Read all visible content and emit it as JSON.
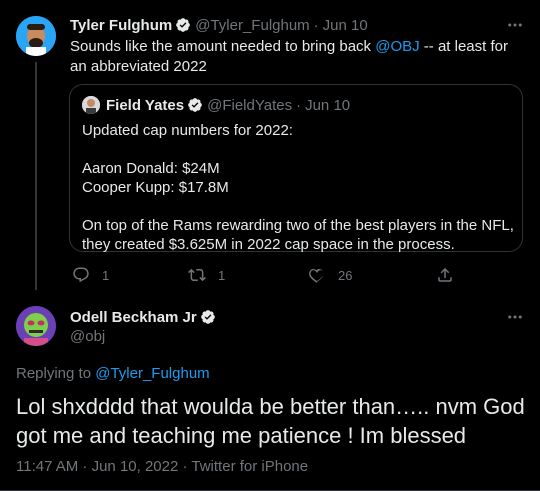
{
  "tweet": {
    "author_name": "Tyler Fulghum",
    "author_handle": "@Tyler_Fulghum",
    "separator": "·",
    "date": "Jun 10",
    "text_before_mention": "Sounds like the amount needed to bring back ",
    "mention": "@OBJ",
    "text_after_mention": " -- at least for an abbreviated 2022",
    "quoted": {
      "author_name": "Field Yates",
      "author_handle": "@FieldYates",
      "separator": "·",
      "date": "Jun 10",
      "lines": [
        "Updated cap numbers for 2022:",
        "",
        "Aaron Donald: $24M",
        "Cooper Kupp: $17.8M",
        "",
        "On top of the Rams rewarding two of the best players in the NFL, they created $3.625M in 2022 cap space in the process."
      ]
    },
    "actions": {
      "reply_count": "1",
      "retweet_count": "1",
      "like_count": "26",
      "reply_icon": "reply-icon",
      "retweet_icon": "retweet-icon",
      "like_icon": "heart-icon",
      "share_icon": "share-icon"
    }
  },
  "reply": {
    "author_name": "Odell Beckham Jr",
    "author_handle": "@obj",
    "replying_to_label": "Replying to ",
    "replying_to_handle": "@Tyler_Fulghum",
    "text": "Lol shxdddd that woulda be better than….. nvm God got me and teaching me patience ! Im blessed",
    "meta": "11:47 AM · Jun 10, 2022 · Twitter for iPhone"
  },
  "colors": {
    "background": "#000000",
    "text": "#e7e9ea",
    "muted": "#71767b",
    "accent": "#1d9bf0",
    "border": "#2f3336"
  }
}
